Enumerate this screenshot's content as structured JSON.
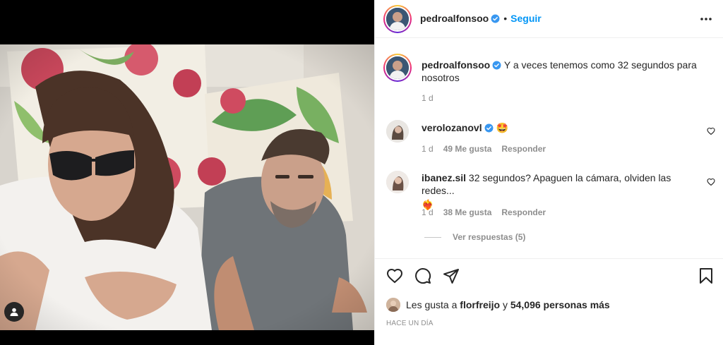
{
  "post": {
    "author": "pedroalfonsoo",
    "follow_label": "Seguir",
    "separator": "•",
    "caption": "Y a veces tenemos como 32 segundos para nosotros",
    "caption_age": "1 d"
  },
  "comments": [
    {
      "user": "verolozanovl",
      "text": "🤩",
      "age": "1 d",
      "likes": "49 Me gusta",
      "reply_label": "Responder"
    },
    {
      "user": "ibanez.sil",
      "text": "32 segundos? Apaguen la cámara, olviden las redes...",
      "text_emoji": "❤️‍🔥",
      "age": "1 d",
      "likes": "38 Me gusta",
      "reply_label": "Responder",
      "view_replies": "Ver respuestas (5)"
    }
  ],
  "likes_line": {
    "prefix": "Les gusta a",
    "user": "florfreijo",
    "middle": "y",
    "count": "54,096 personas más"
  },
  "timestamp": "HACE UN DÍA",
  "colors": {
    "accent": "#0095f6",
    "verified": "#3897f0",
    "muted": "#8e8e8e",
    "text": "#262626"
  },
  "icons": [
    "more-icon",
    "verified-icon",
    "heart-icon",
    "comment-icon",
    "share-icon",
    "bookmark-icon",
    "user-tag-icon"
  ]
}
